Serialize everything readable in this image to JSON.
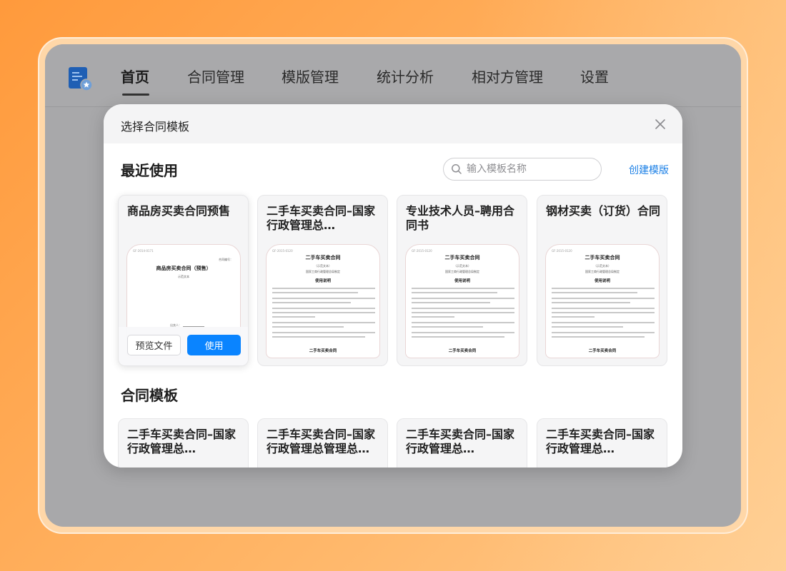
{
  "nav": {
    "items": [
      {
        "label": "首页",
        "active": true
      },
      {
        "label": "合同管理",
        "active": false
      },
      {
        "label": "模版管理",
        "active": false
      },
      {
        "label": "统计分析",
        "active": false
      },
      {
        "label": "相对方管理",
        "active": false
      },
      {
        "label": "设置",
        "active": false
      }
    ]
  },
  "dialog": {
    "title": "选择合同模板",
    "recent_title": "最近使用",
    "templates_title": "合同模板",
    "search_placeholder": "输入模板名称",
    "create_label": "创建模版",
    "preview_label": "预览文件",
    "use_label": "使用"
  },
  "recent": [
    {
      "title": "商品房买卖合同预售",
      "doc_head": "商品房买卖合同（预售）",
      "doc_sub": "示范文本",
      "doc_code": "GF-2014-0171",
      "doc_number_label": "合同编号：",
      "doc_sign_label": "出卖人："
    },
    {
      "title": "二手车买卖合同–国家行政管理总…",
      "doc_head": "二手车买卖合同",
      "doc_sub": "（示范文本）",
      "doc_sub2": "国家工商行政管理总局制定",
      "doc_section": "使用说明",
      "doc_foot": "二手车买卖合同",
      "doc_code": "GF-2015-0120"
    },
    {
      "title": "专业技术人员–聘用合同书",
      "doc_head": "二手车买卖合同",
      "doc_sub": "（示范文本）",
      "doc_sub2": "国家工商行政管理总局制定",
      "doc_section": "使用说明",
      "doc_foot": "二手车买卖合同",
      "doc_code": "GF-2015-0120"
    },
    {
      "title": "钢材买卖（订货）合同",
      "doc_head": "二手车买卖合同",
      "doc_sub": "（示范文本）",
      "doc_sub2": "国家工商行政管理总局制定",
      "doc_section": "使用说明",
      "doc_foot": "二手车买卖合同",
      "doc_code": "GF-2015-0120"
    }
  ],
  "templates": [
    {
      "title": "二手车买卖合同–国家行政管理总…"
    },
    {
      "title": "二手车买卖合同–国家行政管理总管理总…"
    },
    {
      "title": "二手车买卖合同–国家行政管理总…"
    },
    {
      "title": "二手车买卖合同–国家行政管理总…"
    }
  ],
  "colors": {
    "accent": "#0a84ff",
    "link": "#1a7fe6",
    "background_gradient_start": "#ff9a3c"
  }
}
